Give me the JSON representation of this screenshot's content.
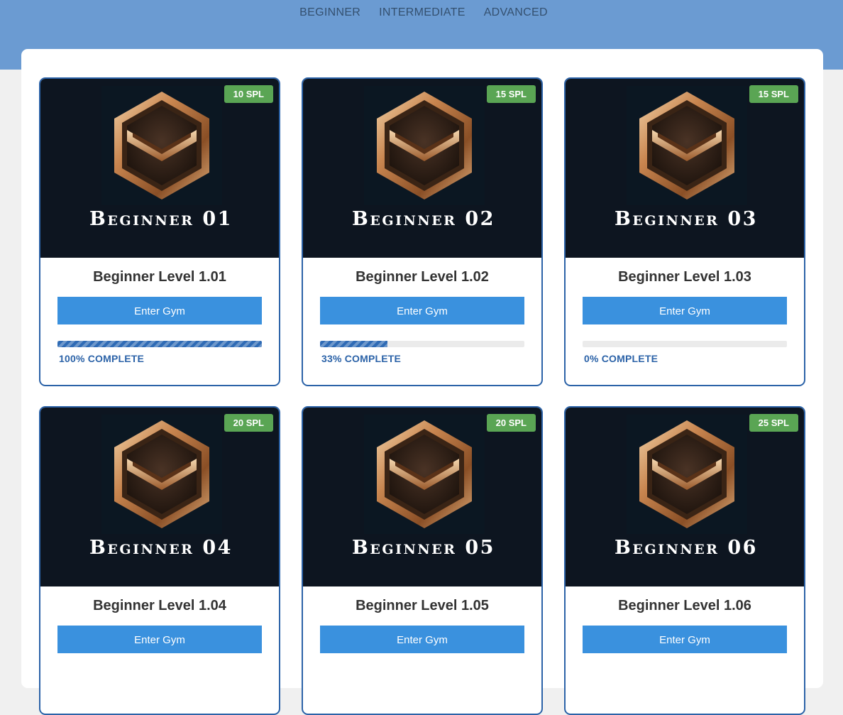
{
  "nav": {
    "tabs": [
      {
        "label": "BEGINNER"
      },
      {
        "label": "INTERMEDIATE"
      },
      {
        "label": "ADVANCED"
      }
    ]
  },
  "colors": {
    "header": "#6b9bd2",
    "badge": "#5aa554",
    "button": "#3a91de",
    "card_border": "#2c63a8",
    "progress": "#2f6bb5"
  },
  "cards": [
    {
      "image_title": "Beginner 01",
      "badge": "10 SPL",
      "title": "Beginner Level 1.01",
      "button": "Enter Gym",
      "progress": 100,
      "progress_label": "100% COMPLETE"
    },
    {
      "image_title": "Beginner 02",
      "badge": "15 SPL",
      "title": "Beginner Level 1.02",
      "button": "Enter Gym",
      "progress": 33,
      "progress_label": "33% COMPLETE"
    },
    {
      "image_title": "Beginner 03",
      "badge": "15 SPL",
      "title": "Beginner Level 1.03",
      "button": "Enter Gym",
      "progress": 0,
      "progress_label": "0% COMPLETE"
    },
    {
      "image_title": "Beginner 04",
      "badge": "20 SPL",
      "title": "Beginner Level 1.04",
      "button": "Enter Gym",
      "progress": null,
      "progress_label": null
    },
    {
      "image_title": "Beginner 05",
      "badge": "20 SPL",
      "title": "Beginner Level 1.05",
      "button": "Enter Gym",
      "progress": null,
      "progress_label": null
    },
    {
      "image_title": "Beginner 06",
      "badge": "25 SPL",
      "title": "Beginner Level 1.06",
      "button": "Enter Gym",
      "progress": null,
      "progress_label": null
    }
  ]
}
